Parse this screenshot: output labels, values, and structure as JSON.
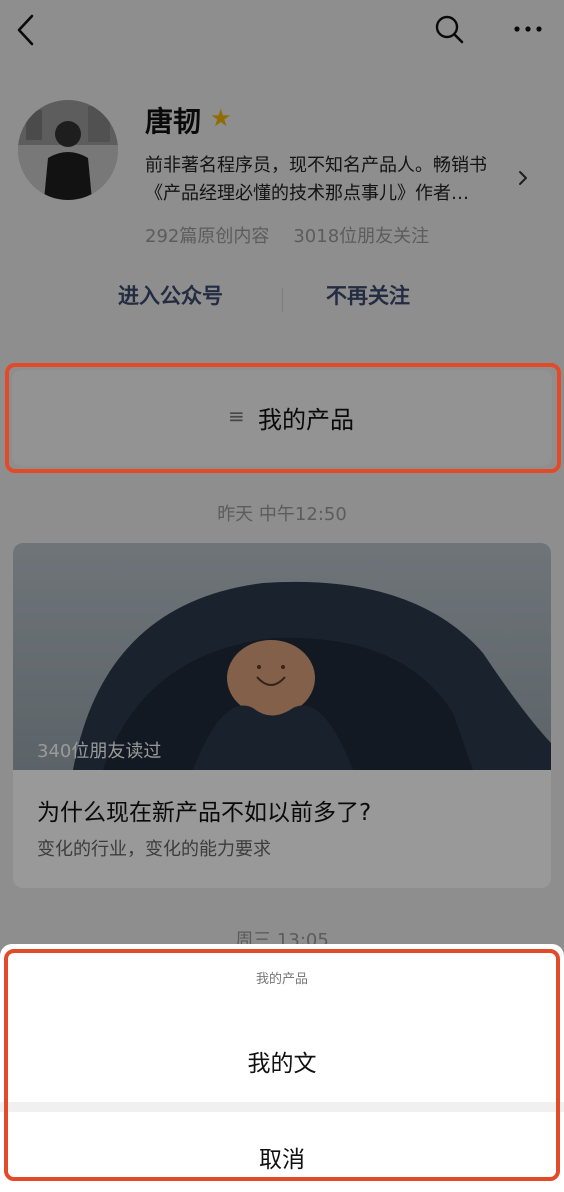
{
  "topbar": {
    "back_icon": "chevron-left-icon",
    "search_icon": "search-icon",
    "more_icon": "more-horizontal-icon"
  },
  "profile": {
    "name": "唐韧",
    "star_icon": "star-icon",
    "bio_line1": "前非著名程序员，现不知名产品人。畅销书",
    "bio_line2": "《产品经理必懂的技术那点事儿》作者…",
    "stats_articles": "292篇原创内容",
    "stats_friends": "3018位朋友关注",
    "action_enter": "进入公众号",
    "action_unfollow": "不再关注"
  },
  "menu": {
    "icon": "menu-lines-icon",
    "label": "我的产品"
  },
  "feed": {
    "timestamp1": "昨天 中午12:50",
    "article": {
      "read_count": "340位朋友读过",
      "title": "为什么现在新产品不如以前多了?",
      "subtitle": "变化的行业，变化的能力要求"
    },
    "timestamp2": "周三 13:05"
  },
  "sheet": {
    "title": "我的产品",
    "option": "我的文",
    "cancel": "取消"
  },
  "colors": {
    "highlight": "#e24a2a",
    "star": "#f2b400",
    "action_text": "#3b4a6d"
  }
}
